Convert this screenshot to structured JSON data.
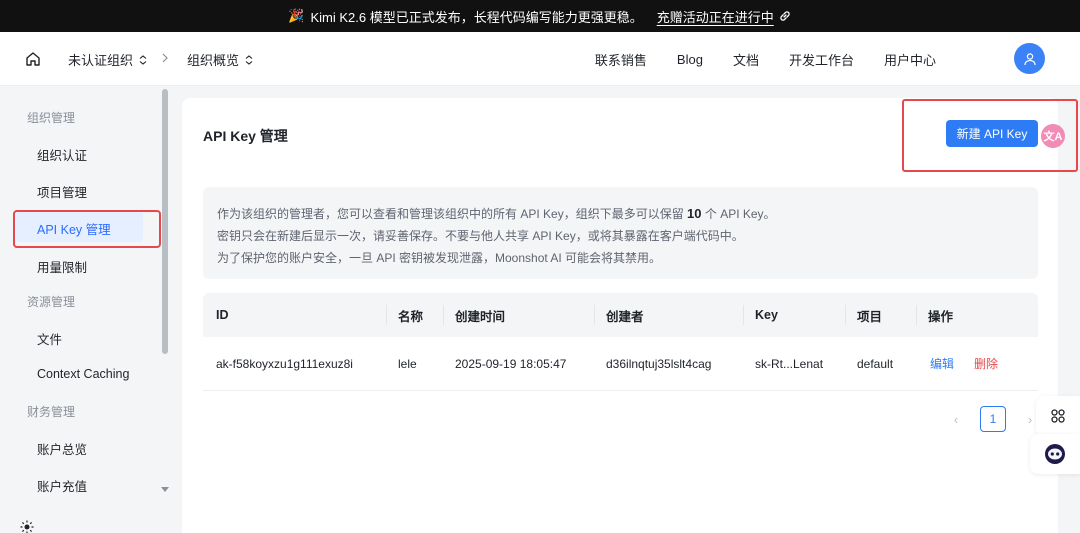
{
  "announcement": {
    "emoji": "🎉",
    "text": "Kimi K2.6 模型已正式发布，长程代码编写能力更强更稳。",
    "link": "充赠活动正在进行中"
  },
  "nav": {
    "org": "未认证组织",
    "page": "组织概览",
    "links": [
      "联系销售",
      "Blog",
      "文档",
      "开发工作台",
      "用户中心"
    ]
  },
  "sidebar": {
    "sections": [
      {
        "title": "组织管理",
        "items": [
          "组织认证",
          "项目管理",
          "API Key 管理",
          "用量限制"
        ]
      },
      {
        "title": "资源管理",
        "items": [
          "文件",
          "Context Caching"
        ]
      },
      {
        "title": "财务管理",
        "items": [
          "账户总览",
          "账户充值"
        ]
      }
    ],
    "active": "API Key 管理"
  },
  "main": {
    "title": "API Key 管理",
    "new_button": "新建 API Key",
    "notice": {
      "line1_pre": "作为该组织的管理者，您可以查看和管理该组织中的所有 API Key，组织下最多可以保留",
      "line1_num": "10",
      "line1_post": "个 API Key。",
      "line2": "密钥只会在新建后显示一次，请妥善保存。不要与他人共享 API Key，或将其暴露在客户端代码中。",
      "line3": "为了保护您的账户安全，一旦 API 密钥被发现泄露，Moonshot AI 可能会将其禁用。"
    },
    "table": {
      "headers": [
        "ID",
        "名称",
        "创建时间",
        "创建者",
        "Key",
        "项目",
        "操作"
      ],
      "rows": [
        {
          "id": "ak-f58koyxzu1g111exuz8i",
          "name": "lele",
          "created": "2025-09-19 18:05:47",
          "creator": "d36ilnqtuj35lslt4cag",
          "key": "sk-Rt...Lenat",
          "project": "default",
          "edit": "编辑",
          "delete": "删除"
        }
      ]
    },
    "pager": {
      "current": "1"
    }
  },
  "translate_badge": "文A",
  "colors": {
    "accent": "#2d7cf6",
    "danger": "#e5484d",
    "highlight": "#e5484d"
  }
}
